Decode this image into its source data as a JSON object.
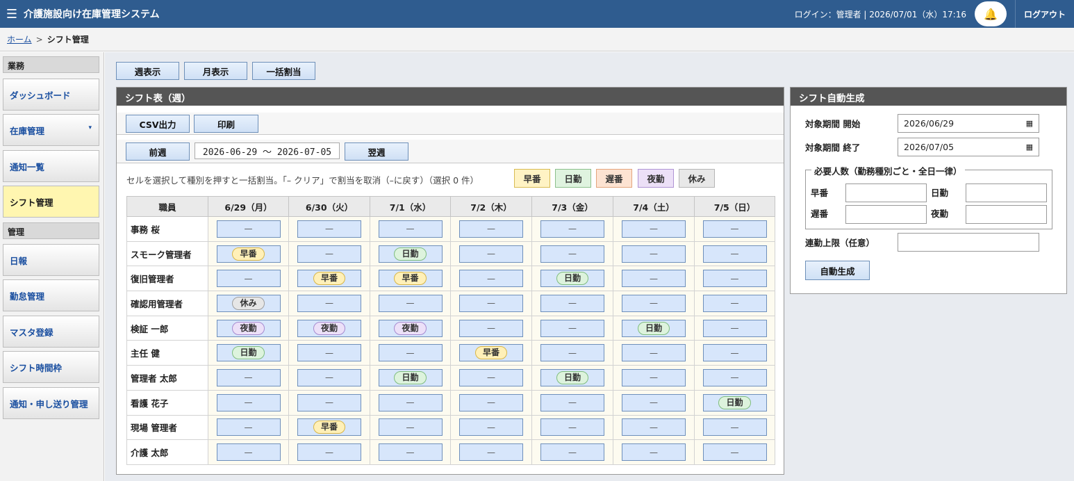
{
  "header": {
    "title": "介護施設向け在庫管理システム",
    "login_info": "ログイン：管理者 | 2026/07/01（水）17:16",
    "logout": "ログアウト",
    "menu_icon": "☰",
    "bell_icon": "🔔"
  },
  "breadcrumb": {
    "home": "ホーム",
    "separator": ">",
    "current": "シフト管理"
  },
  "sidebar": {
    "section_work": "業務",
    "section_admin": "管理",
    "items": [
      {
        "label": "ダッシュボード"
      },
      {
        "label": "在庫管理",
        "caret": "▾"
      },
      {
        "label": "通知一覧"
      },
      {
        "label": "シフト管理"
      },
      {
        "label": "日報"
      },
      {
        "label": "勤怠管理"
      },
      {
        "label": "マスタ登録"
      },
      {
        "label": "シフト時間枠"
      },
      {
        "label": "通知・申し送り管理"
      }
    ]
  },
  "toolbar": {
    "week": "週表示",
    "month": "月表示",
    "bulk": "一括割当"
  },
  "shift": {
    "title": "シフト表（週）",
    "csv": "CSV出力",
    "print": "印刷",
    "prev": "前週",
    "range": "2026-06-29 〜 2026-07-05",
    "next": "翌週",
    "hint": "セルを選択して種別を押すと一括割当。「– クリア」で割当を取消（–に戻す）（選択 0 件）",
    "chips": {
      "early": "早番",
      "day": "日勤",
      "late": "遅番",
      "night": "夜勤",
      "off": "休み"
    },
    "columns": [
      "職員",
      "6/29（月）",
      "6/30（火）",
      "7/1（水）",
      "7/2（木）",
      "7/3（金）",
      "7/4（土）",
      "7/5（日）"
    ],
    "empty": "—",
    "rows": [
      {
        "name": "事務 桜",
        "cells": [
          "—",
          "—",
          "—",
          "—",
          "—",
          "—",
          "—"
        ]
      },
      {
        "name": "スモーク管理者",
        "cells": [
          "早番",
          "—",
          "日勤",
          "—",
          "—",
          "—",
          "—"
        ]
      },
      {
        "name": "復旧管理者",
        "cells": [
          "—",
          "早番",
          "早番",
          "—",
          "日勤",
          "—",
          "—"
        ]
      },
      {
        "name": "確認用管理者",
        "cells": [
          "休み",
          "—",
          "—",
          "—",
          "—",
          "—",
          "—"
        ]
      },
      {
        "name": "検証 一郎",
        "cells": [
          "夜勤",
          "夜勤",
          "夜勤",
          "—",
          "—",
          "日勤",
          "—"
        ]
      },
      {
        "name": "主任 健",
        "cells": [
          "日勤",
          "—",
          "—",
          "早番",
          "—",
          "—",
          "—"
        ]
      },
      {
        "name": "管理者 太郎",
        "cells": [
          "—",
          "—",
          "日勤",
          "—",
          "日勤",
          "—",
          "—"
        ]
      },
      {
        "name": "看護 花子",
        "cells": [
          "—",
          "—",
          "—",
          "—",
          "—",
          "—",
          "日勤"
        ]
      },
      {
        "name": "現場 管理者",
        "cells": [
          "—",
          "早番",
          "—",
          "—",
          "—",
          "—",
          "—"
        ]
      },
      {
        "name": "介護 太郎",
        "cells": [
          "—",
          "—",
          "—",
          "—",
          "—",
          "—",
          "—"
        ]
      }
    ]
  },
  "auto": {
    "title": "シフト自動生成",
    "start_label": "対象期間 開始",
    "start_value": "2026/06/29",
    "end_label": "対象期間 終了",
    "end_value": "2026/07/05",
    "required_legend": "必要人数（勤務種別ごと・全日一律）",
    "early": "早番",
    "day": "日勤",
    "late": "遅番",
    "night": "夜勤",
    "consecutive_label": "連勤上限（任意）",
    "generate": "自動生成",
    "calendar_icon": "▦"
  }
}
